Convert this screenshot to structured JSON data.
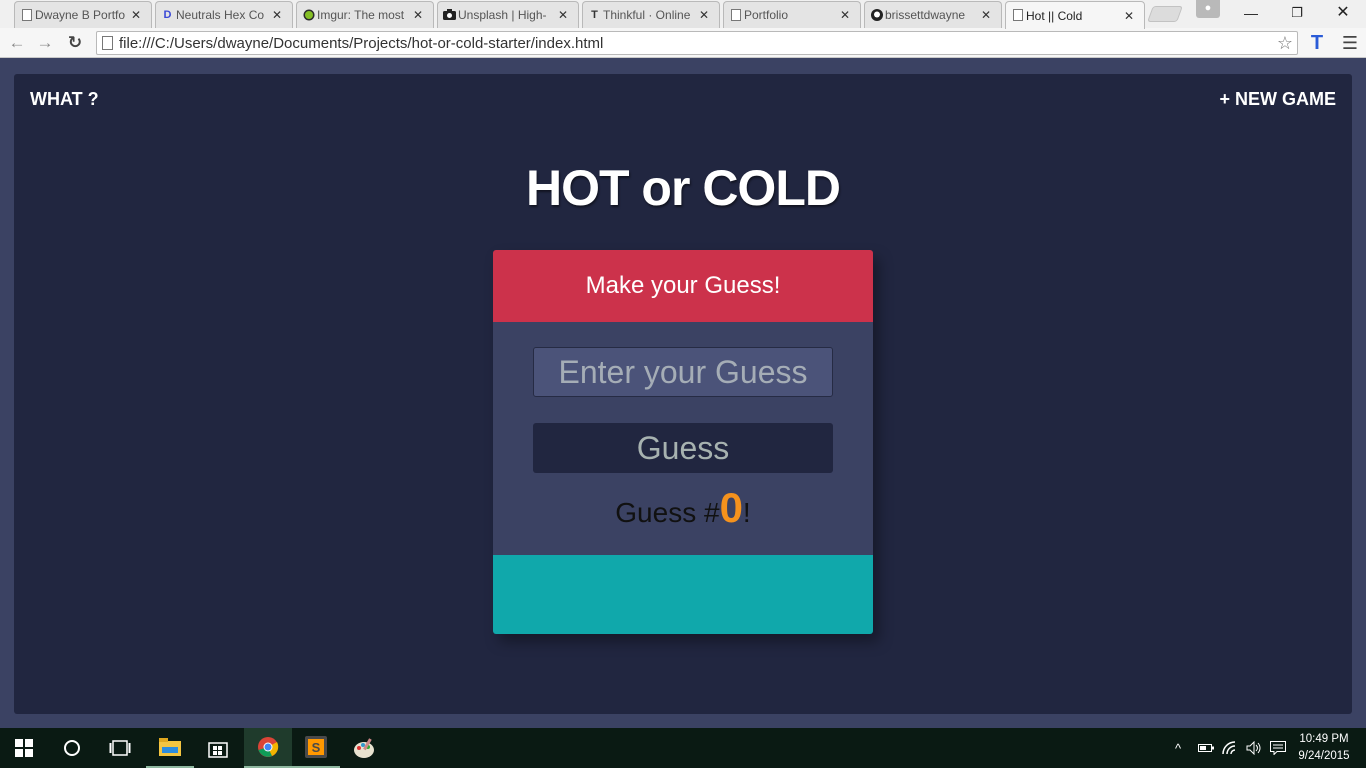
{
  "browser": {
    "tabs": [
      {
        "label": "Dwayne B Portfo",
        "icon": "page-icon"
      },
      {
        "label": "Neutrals Hex Co",
        "icon": "d-logo-icon"
      },
      {
        "label": "Imgur: The most",
        "icon": "imgur-icon"
      },
      {
        "label": "Unsplash | High-",
        "icon": "camera-icon"
      },
      {
        "label": "Thinkful · Online",
        "icon": "thinkful-icon"
      },
      {
        "label": "Portfolio",
        "icon": "page-icon"
      },
      {
        "label": "brissettdwayne",
        "icon": "github-icon"
      },
      {
        "label": "Hot || Cold",
        "icon": "page-icon",
        "active": true
      }
    ],
    "url": "file:///C:/Users/dwayne/Documents/Projects/hot-or-cold-starter/index.html"
  },
  "game": {
    "nav_what": "WHAT ?",
    "nav_new_game": "+ NEW GAME",
    "title": "HOT or COLD",
    "feedback": "Make your Guess!",
    "input_placeholder": "Enter your Guess",
    "guess_button": "Guess",
    "count_prefix": "Guess #",
    "count": "0",
    "count_suffix": "!",
    "colors": {
      "background": "#212640",
      "header": "#cc324b",
      "body": "#3b4263",
      "footer": "#10a8ab",
      "count": "#f5921d"
    }
  },
  "taskbar": {
    "time": "10:49 PM",
    "date": "9/24/2015"
  }
}
